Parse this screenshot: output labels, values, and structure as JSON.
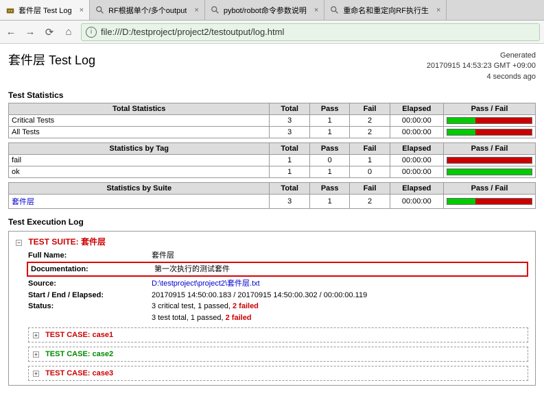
{
  "browser": {
    "tabs": [
      {
        "title": "套件层 Test Log"
      },
      {
        "title": "RF根据单个/多个output"
      },
      {
        "title": "pybot/robot命令参数说明"
      },
      {
        "title": "重命名和重定向RF执行生"
      }
    ],
    "url": "file:///D:/testproject/project2/testoutput/log.html"
  },
  "header": {
    "title": "套件层 Test Log",
    "generated": "Generated",
    "timestamp": "20170915 14:53:23 GMT +09:00",
    "ago": "4 seconds ago"
  },
  "stats": {
    "section_title": "Test Statistics",
    "cols": {
      "total": "Total",
      "pass": "Pass",
      "fail": "Fail",
      "elapsed": "Elapsed",
      "pf": "Pass / Fail"
    },
    "total_head": "Total Statistics",
    "total_rows": [
      {
        "name": "Critical Tests",
        "total": "3",
        "pass": "1",
        "fail": "2",
        "elapsed": "00:00:00",
        "passpct": 33
      },
      {
        "name": "All Tests",
        "total": "3",
        "pass": "1",
        "fail": "2",
        "elapsed": "00:00:00",
        "passpct": 33
      }
    ],
    "tag_head": "Statistics by Tag",
    "tag_rows": [
      {
        "name": "fail",
        "total": "1",
        "pass": "0",
        "fail": "1",
        "elapsed": "00:00:00",
        "passpct": 0
      },
      {
        "name": "ok",
        "total": "1",
        "pass": "1",
        "fail": "0",
        "elapsed": "00:00:00",
        "passpct": 100
      }
    ],
    "suite_head": "Statistics by Suite",
    "suite_rows": [
      {
        "name": "套件层",
        "total": "3",
        "pass": "1",
        "fail": "2",
        "elapsed": "00:00:00",
        "passpct": 33
      }
    ]
  },
  "execlog": {
    "section_title": "Test Execution Log",
    "suite_label": "TEST SUITE:",
    "suite_name": "套件层",
    "fullname_label": "Full Name:",
    "fullname_value": "套件层",
    "doc_label": "Documentation:",
    "doc_value": "第一次执行的测试套件",
    "source_label": "Source:",
    "source_value": "D:\\testproject\\project2\\套件层.txt",
    "times_label": "Start / End / Elapsed:",
    "times_value": "20170915 14:50:00.183 / 20170915 14:50:00.302 / 00:00:00.119",
    "status_label": "Status:",
    "status_line1a": "3 critical test, 1 passed, ",
    "status_line1b": "2 failed",
    "status_line2a": "3 test total, 1 passed, ",
    "status_line2b": "2 failed",
    "tc_label": "TEST CASE:",
    "cases": [
      {
        "name": "case1",
        "status": "fail"
      },
      {
        "name": "case2",
        "status": "pass"
      },
      {
        "name": "case3",
        "status": "fail"
      }
    ]
  }
}
